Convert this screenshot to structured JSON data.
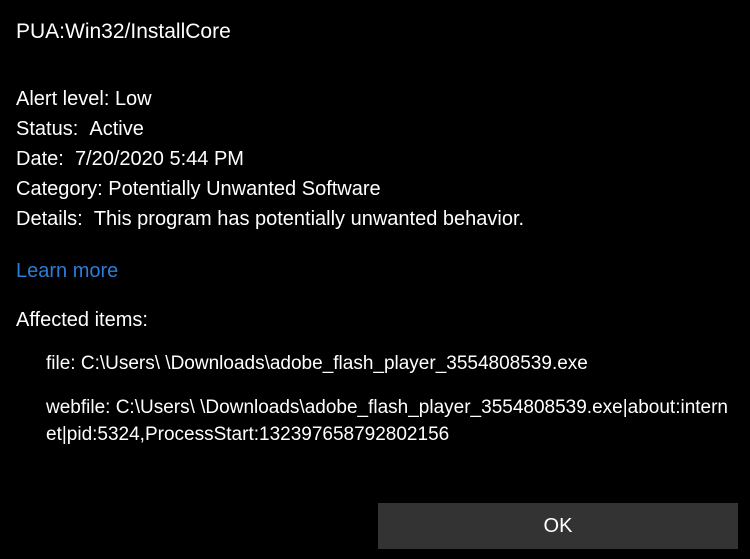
{
  "threat_name": "PUA:Win32/InstallCore",
  "info": {
    "alert_level": {
      "label": "Alert level:",
      "value": " Low"
    },
    "status": {
      "label": "Status:",
      "value": "  Active"
    },
    "date": {
      "label": "Date:",
      "value": "  7/20/2020 5:44 PM"
    },
    "category": {
      "label": "Category:",
      "value": " Potentially Unwanted Software"
    },
    "details": {
      "label": "Details:",
      "value": "  This program has potentially unwanted behavior."
    }
  },
  "learn_more": "Learn more",
  "affected_heading": "Affected items:",
  "affected_items": [
    "file: C:\\Users\\           \\Downloads\\adobe_flash_player_3554808539.exe",
    "webfile: C:\\Users\\             \\Downloads\\adobe_flash_player_3554808539.exe|about:internet|pid:5324,ProcessStart:132397658792802156"
  ],
  "ok_label": "OK"
}
